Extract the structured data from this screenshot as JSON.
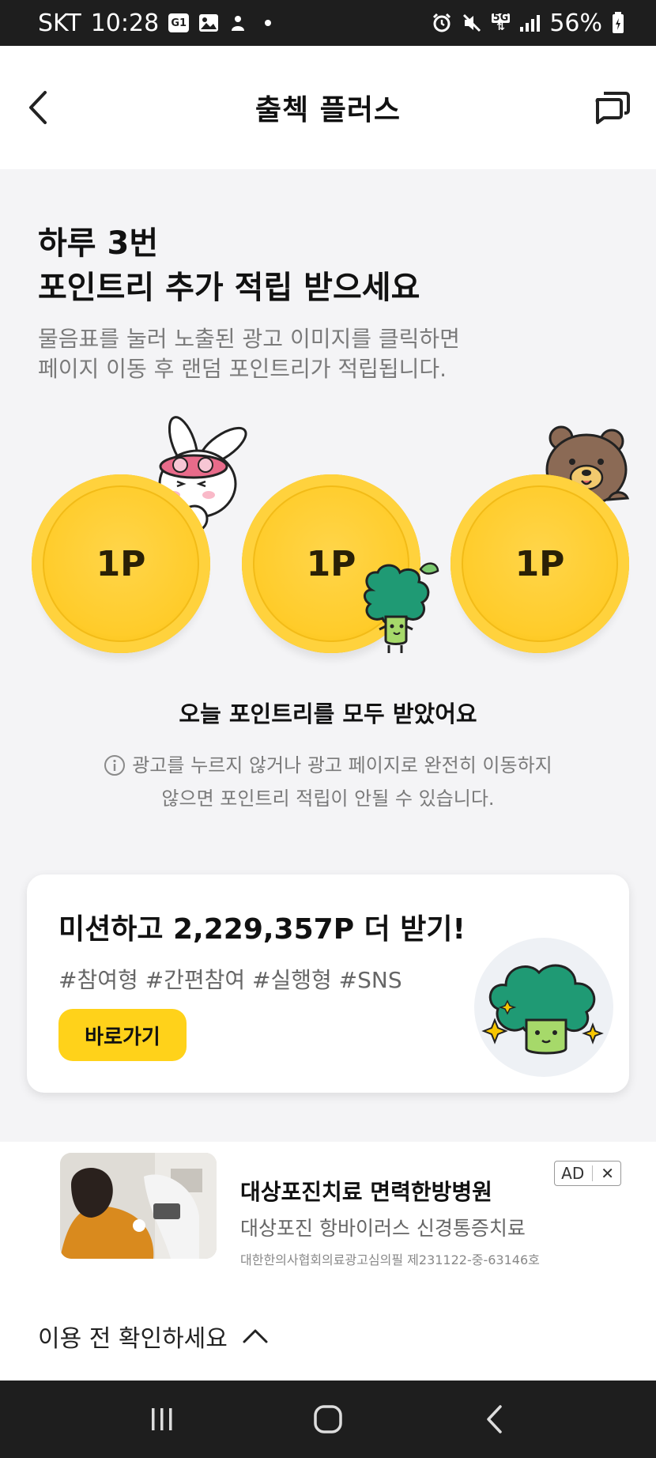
{
  "status_bar": {
    "carrier": "SKT",
    "time": "10:28",
    "battery": "56%",
    "icons": [
      "g1-badge-icon",
      "gallery-icon",
      "shortcut-icon",
      "dot-icon",
      "alarm-icon",
      "mute-icon",
      "5g-icon",
      "signal-icon",
      "battery-icon"
    ],
    "g1": "G1",
    "net": "5G"
  },
  "header": {
    "title": "출첵 플러스",
    "back_icon": "chevron-left-icon",
    "chat_icon": "chat-bubbles-icon"
  },
  "hero": {
    "title_line1": "하루 3번",
    "title_line2": "포인트리 추가 적립 받으세요",
    "desc_line1": "물음표를 눌러 노출된 광고 이미지를 클릭하면",
    "desc_line2": "페이지 이동 후 랜덤 포인트리가 적립됩니다."
  },
  "coins": [
    {
      "label": "1P",
      "character": "rabbit"
    },
    {
      "label": "1P",
      "character": "broccoli"
    },
    {
      "label": "1P",
      "character": "bear"
    }
  ],
  "status_message": "오늘 포인트리를 모두 받았어요",
  "notice": {
    "line1": "광고를 누르지 않거나 광고 페이지로 완전히 이동하지",
    "line2": "않으면 포인트리 적립이 안될 수 있습니다."
  },
  "mission": {
    "title": "미션하고 2,229,357P 더 받기!",
    "tags": "#참여형 #간편참여 #실행형 #SNS",
    "button_label": "바로가기"
  },
  "ad": {
    "title": "대상포진치료 면력한방병원",
    "subtitle": "대상포진 항바이러스 신경통증치료",
    "fine_print": "대한한의사협회의료광고심의필 제231122-중-63146호",
    "badge_label": "AD",
    "close_label": "✕"
  },
  "bottom": {
    "label": "이용 전 확인하세요"
  },
  "nav": {
    "icons": [
      "recent-apps-icon",
      "home-icon",
      "back-icon"
    ]
  },
  "colors": {
    "accent": "#ffd21a",
    "coin": "#ffcc2a",
    "background": "#f4f4f6",
    "broccoli": "#1f9a74"
  }
}
